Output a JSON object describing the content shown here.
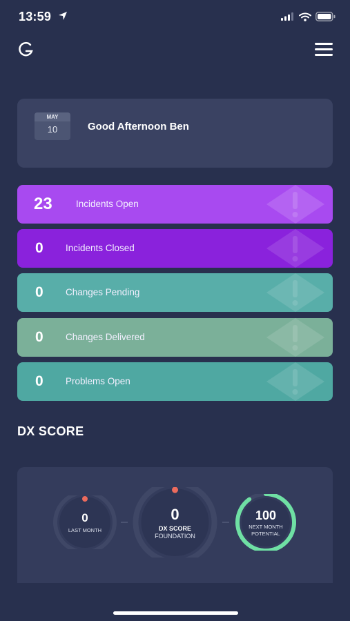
{
  "status_bar": {
    "time": "13:59"
  },
  "greeting": {
    "month": "MAY",
    "day": "10",
    "text": "Good Afternoon Ben"
  },
  "stats": [
    {
      "value": "23",
      "label": "Incidents Open",
      "color": "#a84af0"
    },
    {
      "value": "0",
      "label": "Incidents Closed",
      "color": "#8a22dc"
    },
    {
      "value": "0",
      "label": "Changes Pending",
      "color": "#58aea9"
    },
    {
      "value": "0",
      "label": "Changes Delivered",
      "color": "#7bb099"
    },
    {
      "value": "0",
      "label": "Problems Open",
      "color": "#4fa8a2"
    }
  ],
  "dx_score": {
    "title": "DX SCORE",
    "last_month": {
      "value": "0",
      "label": "LAST MONTH"
    },
    "current": {
      "value": "0",
      "label_line1": "DX SCORE",
      "label_line2": "FOUNDATION"
    },
    "next_month": {
      "value": "100",
      "label_line1": "NEXT MONTH",
      "label_line2": "POTENTIAL",
      "progress": 0.9
    }
  },
  "colors": {
    "accent_green": "#6fe0a4",
    "dot_red": "#ec6b5d"
  }
}
